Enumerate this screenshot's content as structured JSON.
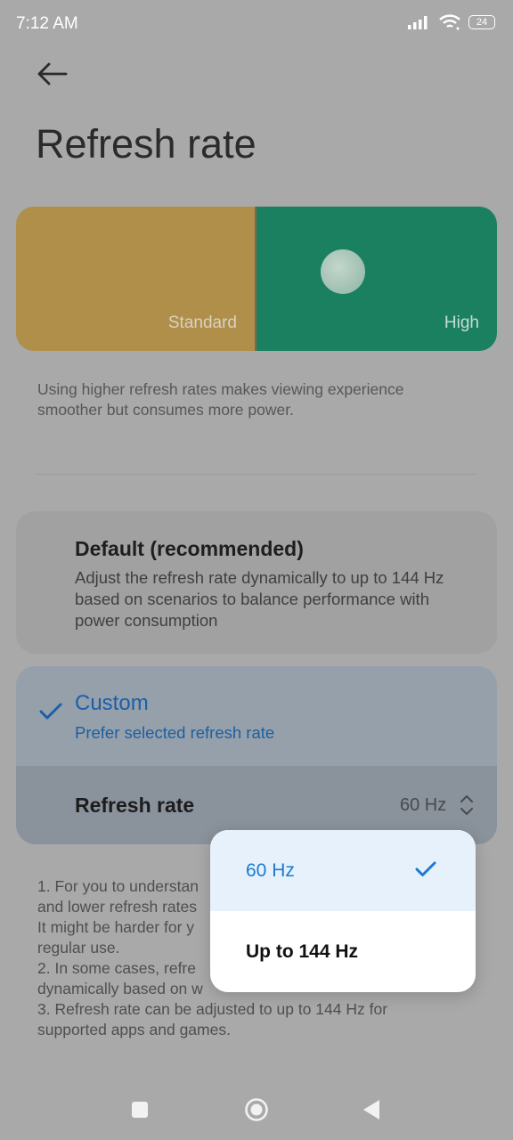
{
  "status_bar": {
    "time": "7:12 AM",
    "battery": "24",
    "icons": [
      "signal-icon",
      "wifi-icon",
      "battery-icon"
    ]
  },
  "header": {
    "back_icon": "arrow-left-icon",
    "title": "Refresh rate"
  },
  "slider": {
    "options": [
      "Standard",
      "High"
    ],
    "selected": "High"
  },
  "description": "Using higher refresh rates makes viewing experience smoother but consumes more power.",
  "options": {
    "default": {
      "title": "Default (recommended)",
      "description": "Adjust the refresh rate dynamically to up to 144 Hz based on scenarios to balance performance with power consumption"
    },
    "custom": {
      "title": "Custom",
      "subtitle": "Prefer selected refresh rate",
      "selected": true
    }
  },
  "refresh_rate_row": {
    "label": "Refresh rate",
    "value": "60 Hz"
  },
  "notes": {
    "line1": "1. For you to understan",
    "line2": "and lower refresh rates",
    "line3": "It might be harder for y",
    "line4": "regular use.",
    "line5": "2. In some cases, refre",
    "line6": "dynamically based on w",
    "line7": "3. Refresh rate can be adjusted to up to 144 Hz for",
    "line8": "supported apps and games."
  },
  "dropdown": {
    "items": [
      {
        "label": "60 Hz",
        "selected": true
      },
      {
        "label": "Up to 144 Hz",
        "selected": false
      }
    ]
  },
  "nav_bar": {
    "icons": [
      "recents-square-icon",
      "home-circle-icon",
      "back-triangle-icon"
    ]
  },
  "colors": {
    "accent": "#1a7ad6",
    "standard_segment": "#b08f4a",
    "high_segment": "#1a805f"
  }
}
